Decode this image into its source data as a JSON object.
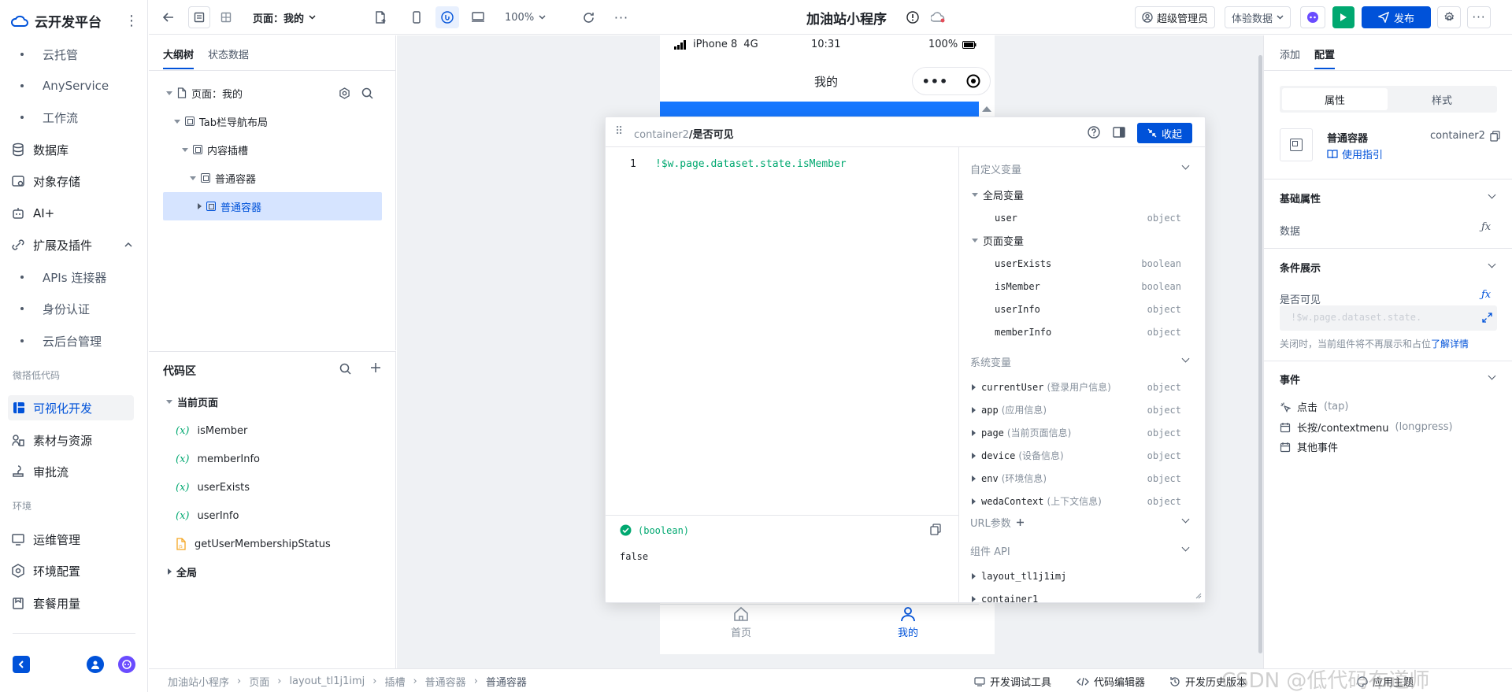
{
  "nav": {
    "brand": "云开发平台",
    "items": [
      {
        "label": "云托管",
        "sub": true
      },
      {
        "label": "AnyService",
        "sub": true
      },
      {
        "label": "工作流",
        "sub": true
      },
      {
        "label": "数据库",
        "icon": "database-icon"
      },
      {
        "label": "对象存储",
        "icon": "storage-icon"
      },
      {
        "label": "AI+",
        "icon": "robot-icon"
      },
      {
        "label": "扩展及插件",
        "icon": "plugin-icon"
      },
      {
        "label": "APIs 连接器",
        "sub": true
      },
      {
        "label": "身份认证",
        "sub": true
      },
      {
        "label": "云后台管理",
        "sub": true
      }
    ],
    "section_lowcode": "微搭低代码",
    "lowcode_items": [
      {
        "label": "可视化开发",
        "icon": "layout-icon"
      },
      {
        "label": "素材与资源",
        "icon": "assets-icon"
      },
      {
        "label": "审批流",
        "icon": "approval-icon"
      }
    ],
    "section_env": "环境",
    "env_items": [
      {
        "label": "运维管理",
        "icon": "ops-icon"
      },
      {
        "label": "环境配置",
        "icon": "env-config-icon"
      },
      {
        "label": "套餐用量",
        "icon": "package-icon"
      }
    ]
  },
  "toolbar": {
    "page_label": "页面：我的",
    "zoom": "100%",
    "app_title": "加油站小程序",
    "admin": "超级管理员",
    "experience": "体验数据",
    "publish": "发布"
  },
  "tree": {
    "tab_outline": "大纲树",
    "tab_state": "状态数据",
    "nodes": [
      "页面：我的",
      "Tab栏导航布局",
      "内容插槽",
      "普通容器",
      "普通容器"
    ]
  },
  "code": {
    "title": "代码区",
    "current_page": "当前页面",
    "vars": [
      "isMember",
      "memberInfo",
      "userExists",
      "userInfo"
    ],
    "func": "getUserMembershipStatus",
    "global": "全局"
  },
  "phone": {
    "carrier": "iPhone 8",
    "network": "4G",
    "time": "10:31",
    "battery": "100%",
    "page_title": "我的",
    "tab_home": "首页",
    "tab_mine": "我的"
  },
  "popup": {
    "path_prefix": "container2",
    "path_name": "/是否可见",
    "collapse": "收起",
    "line_no": "1",
    "expression": "!$w.page.dataset.state.isMember",
    "result_type": "(boolean)",
    "result_value": "false",
    "custom_vars": "自定义变量",
    "global_vars": "全局变量",
    "global_list": [
      {
        "name": "user",
        "type": "object"
      }
    ],
    "page_vars": "页面变量",
    "page_list": [
      {
        "name": "userExists",
        "type": "boolean"
      },
      {
        "name": "isMember",
        "type": "boolean"
      },
      {
        "name": "userInfo",
        "type": "object"
      },
      {
        "name": "memberInfo",
        "type": "object"
      }
    ],
    "system_vars": "系统变量",
    "system_list": [
      {
        "name": "currentUser",
        "desc": "(登录用户信息)",
        "type": "object"
      },
      {
        "name": "app",
        "desc": "(应用信息)",
        "type": "object"
      },
      {
        "name": "page",
        "desc": "(当前页面信息)",
        "type": "object"
      },
      {
        "name": "device",
        "desc": "(设备信息)",
        "type": "object"
      },
      {
        "name": "env",
        "desc": "(环境信息)",
        "type": "object"
      },
      {
        "name": "wedaContext",
        "desc": "(上下文信息)",
        "type": "object"
      }
    ],
    "url_params": "URL参数",
    "comp_api": "组件 API",
    "comp_list": [
      "layout_tl1j1imj",
      "container1"
    ]
  },
  "right": {
    "tab_add": "添加",
    "tab_config": "配置",
    "seg_props": "属性",
    "seg_style": "样式",
    "comp_name": "普通容器",
    "comp_id": "container2",
    "guide": "使用指引",
    "basic": "基础属性",
    "data": "数据",
    "condition": "条件展示",
    "visible": "是否可见",
    "visible_expr": "!$w.page.dataset.state.",
    "hint": "关闭时，当前组件将不再展示和占位",
    "hint_link": "了解详情",
    "events": "事件",
    "event_click": "点击",
    "event_click_sub": "(tap)",
    "event_long": "长按/contextmenu",
    "event_long_sub": "(longpress)",
    "event_other": "其他事件"
  },
  "bottom": {
    "breadcrumbs": [
      "加油站小程序",
      "页面",
      "layout_tl1j1imj",
      "插槽",
      "普通容器",
      "普通容器"
    ],
    "debug": "开发调试工具",
    "editor": "代码编辑器",
    "history": "开发历史版本",
    "theme": "应用主题",
    "watermark": "CSDN @低代码布道师"
  },
  "colors": {
    "accent": "#0052d9",
    "green": "#00a870",
    "phone_blue": "#1677ff"
  }
}
